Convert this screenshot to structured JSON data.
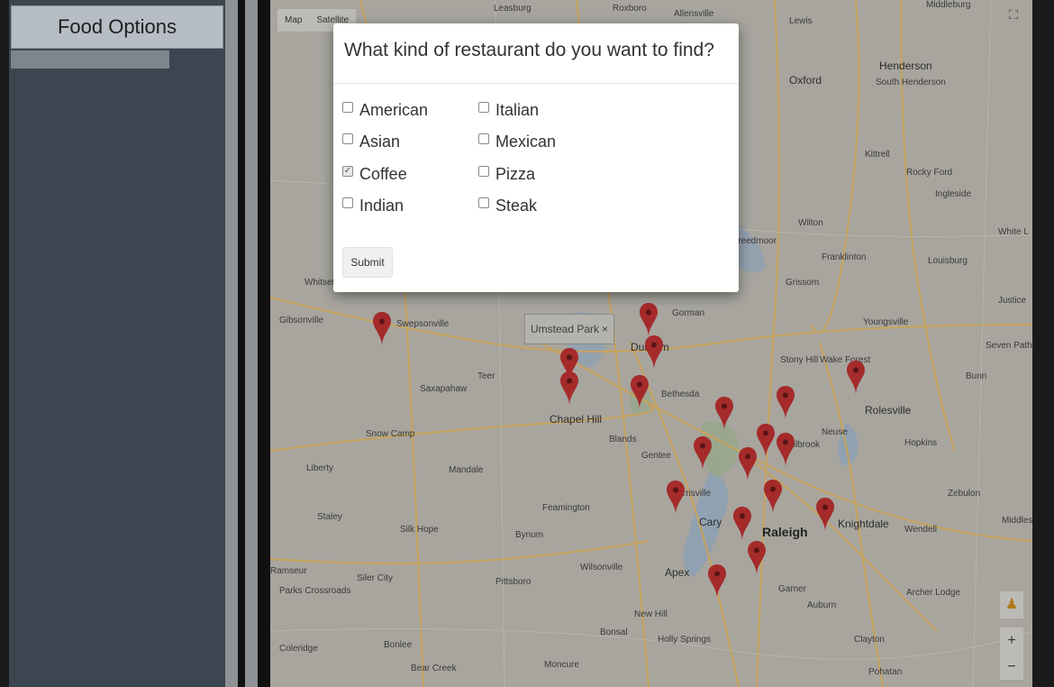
{
  "sidebar": {
    "title": "Food Options"
  },
  "map": {
    "controls": {
      "map_label": "Map",
      "satellite_label": "Satellite",
      "zoom_in": "+",
      "zoom_out": "−",
      "fullscreen_icon": "⛶",
      "pegman_icon": "♟"
    },
    "tooltip": {
      "label": "Umstead Park",
      "close": "×"
    },
    "places": [
      "Leasburg",
      "Roxboro",
      "Allensville",
      "Middleburg",
      "Lewis",
      "Henderson",
      "South Henderson",
      "Oxford",
      "Kittrell",
      "Rocky Ford",
      "Ingleside",
      "Wilton",
      "Creedmoor",
      "Franklinton",
      "Louisburg",
      "White L",
      "Grissom",
      "Youngsville",
      "Justice",
      "Seven Paths",
      "Wake Forest",
      "Stony Hill",
      "Bunn",
      "Rolesville",
      "Gorman",
      "Swepsonville",
      "Saxapahaw",
      "Teer",
      "Chapel Hill",
      "Bethesda",
      "Blands",
      "Gentee",
      "Snow Camp",
      "Liberty",
      "Mandale",
      "Staley",
      "Silk Hope",
      "Bynum",
      "Pittsboro",
      "Siler City",
      "Wilsonville",
      "Apex",
      "Cary",
      "Raleigh",
      "Garner",
      "Knightdale",
      "Wendell",
      "Zebulon",
      "Middlesex",
      "Hopkins",
      "Neuse",
      "Archer Lodge",
      "Auburn",
      "Clayton",
      "Holly Springs",
      "New Hill",
      "Bonsal",
      "Moncure",
      "Bear Creek",
      "Bonlee",
      "Coleridge",
      "Parks Crossroads",
      "Ramseur",
      "Feamington",
      "Whitsett",
      "Gibsonville",
      "Durham",
      "Morrisville",
      "Millbrook",
      "Pohatan"
    ]
  },
  "modal": {
    "title": "What kind of restaurant do you want to find?",
    "options": [
      {
        "label": "American",
        "checked": false
      },
      {
        "label": "Asian",
        "checked": false
      },
      {
        "label": "Coffee",
        "checked": true
      },
      {
        "label": "Indian",
        "checked": false
      },
      {
        "label": "Italian",
        "checked": false
      },
      {
        "label": "Mexican",
        "checked": false
      },
      {
        "label": "Pizza",
        "checked": false
      },
      {
        "label": "Steak",
        "checked": false
      }
    ],
    "submit_label": "Submit",
    "check_mark": "✓"
  },
  "colors": {
    "pin": "#a52a2a",
    "road": "#c9a35a",
    "water": "#8ba0b6",
    "park": "#98a68a"
  }
}
